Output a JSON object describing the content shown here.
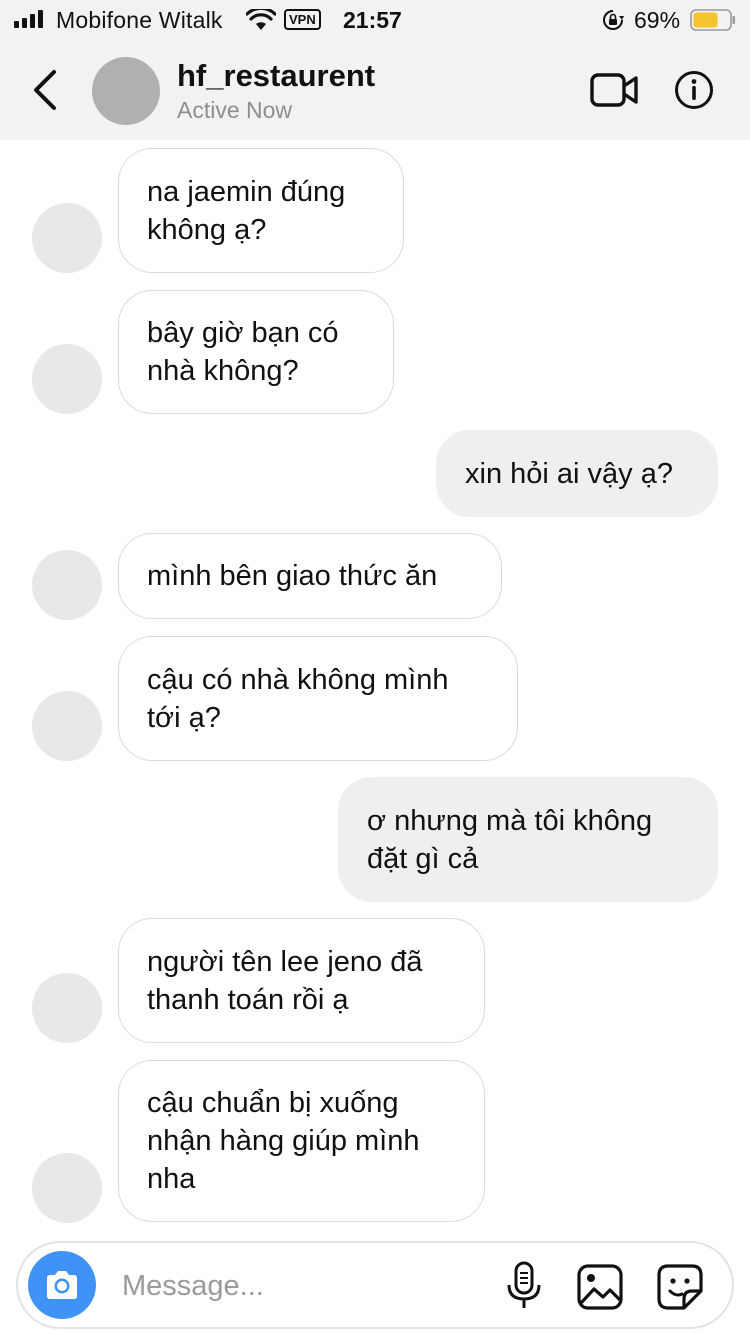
{
  "status_bar": {
    "carrier": "Mobifone Witalk",
    "vpn": "VPN",
    "time": "21:57",
    "battery": "69%",
    "battery_level": 0.69,
    "battery_color": "#f4c430"
  },
  "header": {
    "contact_name": "hf_restaurent",
    "status": "Active Now"
  },
  "messages": [
    {
      "direction": "incoming",
      "text": "na jaemin đúng\nkhông ạ?"
    },
    {
      "direction": "incoming",
      "text": "bây giờ bạn có\nnhà không?"
    },
    {
      "direction": "outgoing",
      "text": "xin hỏi ai vậy ạ?"
    },
    {
      "direction": "incoming",
      "text": "mình bên giao thức ăn"
    },
    {
      "direction": "incoming",
      "text": "cậu có nhà không mình\ntới ạ?"
    },
    {
      "direction": "outgoing",
      "text": "ơ nhưng mà tôi không\nđặt gì cả"
    },
    {
      "direction": "incoming",
      "text": "người tên lee jeno đã\nthanh toán rồi ạ"
    },
    {
      "direction": "incoming",
      "text": "cậu chuẩn bị xuống\nnhận hàng giúp mình\nnha"
    }
  ],
  "composer": {
    "placeholder": "Message...",
    "accent": "#3f93f7"
  },
  "icons": {
    "back": "chevron-left-icon",
    "video": "video-camera-icon",
    "info": "info-icon",
    "camera": "camera-icon",
    "mic": "microphone-icon",
    "gallery": "image-icon",
    "sticker": "sticker-icon"
  }
}
